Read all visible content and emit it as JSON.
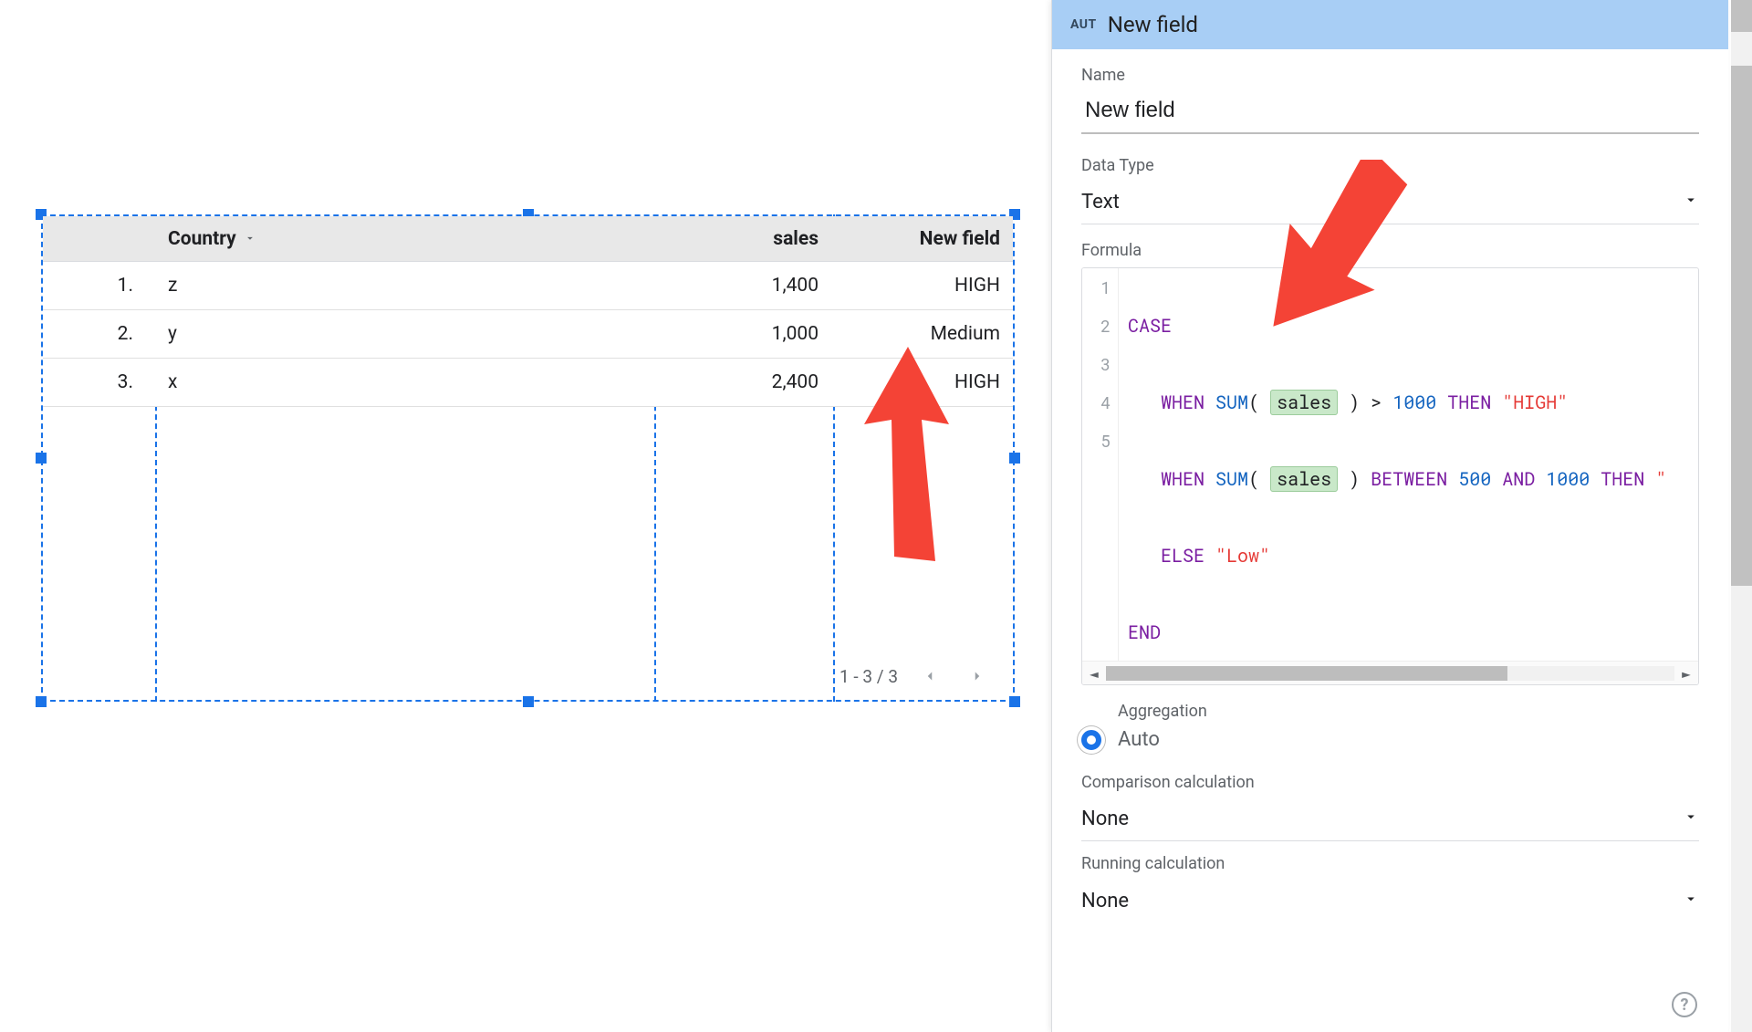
{
  "table": {
    "columns": {
      "country": "Country",
      "sales": "sales",
      "newfield": "New field"
    },
    "rows": [
      {
        "idx": "1.",
        "country": "z",
        "sales": "1,400",
        "newfield": "HIGH"
      },
      {
        "idx": "2.",
        "country": "y",
        "sales": "1,000",
        "newfield": "Medium"
      },
      {
        "idx": "3.",
        "country": "x",
        "sales": "2,400",
        "newfield": "HIGH"
      }
    ],
    "pager": "1 - 3 / 3"
  },
  "panel": {
    "badge": "AUT",
    "title": "New field",
    "name_label": "Name",
    "name_value": "New field",
    "datatype_label": "Data Type",
    "datatype_value": "Text",
    "formula_label": "Formula",
    "formula": {
      "line_numbers": [
        "1",
        "2",
        "3",
        "4",
        "5"
      ],
      "kw_case": "CASE",
      "kw_when": "WHEN",
      "fn_sum": "SUM",
      "open": "(",
      "close": ")",
      "field_sales": "sales",
      "gt": ">",
      "n1000": "1000",
      "kw_then": "THEN",
      "str_high": "\"HIGH\"",
      "kw_between": "BETWEEN",
      "n500": "500",
      "kw_and": "AND",
      "then_trunc": "\"",
      "kw_else": "ELSE",
      "str_low": "\"Low\"",
      "kw_end": "END"
    },
    "agg_label": "Aggregation",
    "agg_value": "Auto",
    "comparison_label": "Comparison calculation",
    "comparison_value": "None",
    "running_label": "Running calculation",
    "running_value": "None"
  }
}
